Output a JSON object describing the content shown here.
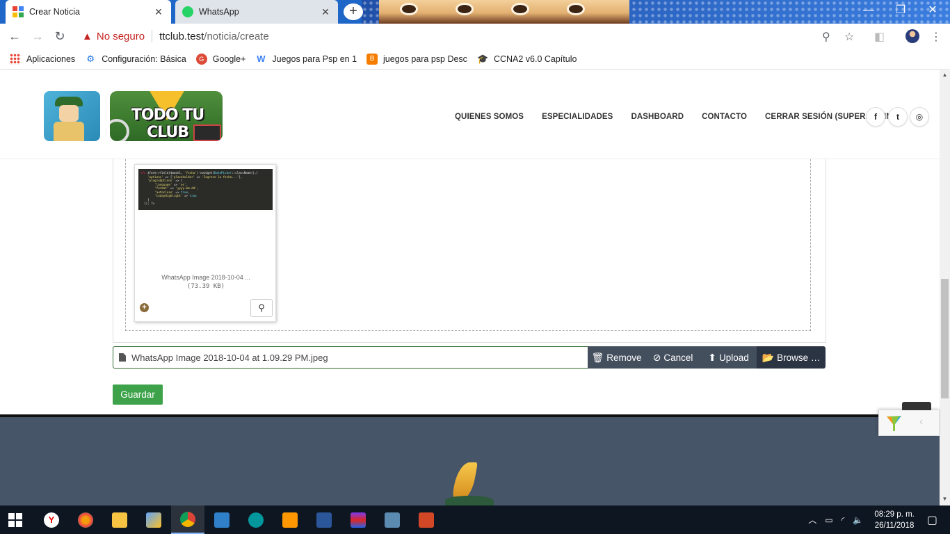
{
  "browser": {
    "tabs": [
      {
        "title": "Crear Noticia",
        "active": true
      },
      {
        "title": "WhatsApp",
        "active": false
      }
    ],
    "security_label": "No seguro",
    "url_host": "ttclub.test",
    "url_path": "/noticia/create"
  },
  "bookmarks": [
    {
      "label": "Aplicaciones",
      "icon": "apps-grid-icon"
    },
    {
      "label": "Configuración: Básica",
      "icon": "gear-icon"
    },
    {
      "label": "Google+",
      "icon": "google-plus-icon"
    },
    {
      "label": "Juegos para Psp en 1",
      "icon": "wikipedia-icon"
    },
    {
      "label": "juegos para psp Desc",
      "icon": "blogger-icon"
    },
    {
      "label": "CCNA2 v6.0 Capítulo",
      "icon": "graduation-cap-icon"
    }
  ],
  "site": {
    "logo_text": "TODO TU CLUB",
    "nav": [
      "QUIENES SOMOS",
      "ESPECIALIDADES",
      "DASHBOARD",
      "CONTACTO",
      "CERRAR SESIÓN (SUPERADMIN)"
    ],
    "social": [
      {
        "name": "facebook-icon",
        "glyph": "f"
      },
      {
        "name": "twitter-icon",
        "glyph": "t"
      },
      {
        "name": "instagram-icon",
        "glyph": "◎"
      }
    ]
  },
  "file_input": {
    "preview_caption": "WhatsApp Image 2018-10-04 ...",
    "preview_size": "(73.39 KB)",
    "caption_filename": "WhatsApp Image 2018-10-04 at 1.09.29 PM.jpeg",
    "remove_label": "Remove",
    "cancel_label": "Cancel",
    "upload_label": "Upload",
    "browse_label": "Browse …"
  },
  "form": {
    "save_label": "Guardar"
  },
  "taskbar": {
    "time": "08:29 p. m.",
    "date": "26/11/2018"
  },
  "colors": {
    "save_button": "#3da24a",
    "file_buttons": "#444f5e",
    "browse_button": "#2b3442",
    "footer": "#475569",
    "insecure": "#c5221f"
  }
}
